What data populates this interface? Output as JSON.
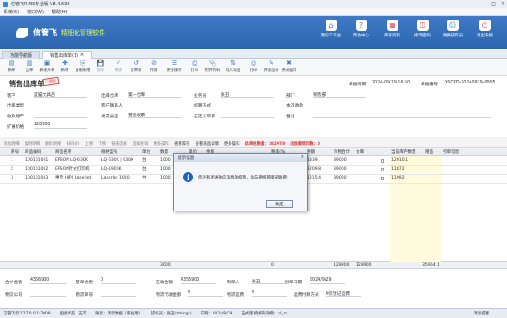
{
  "app": {
    "title": "信管飞RMIS专业版 V8.4.638"
  },
  "menu": [
    "系统(S)",
    "窗口(W)",
    "帮助(H)"
  ],
  "banner": {
    "brand": "信管飞",
    "slogan": "精细化管理软件",
    "buttons": [
      {
        "label": "我的工作台",
        "icon": "home-icon"
      },
      {
        "label": "帮助中心",
        "icon": "help-icon"
      },
      {
        "label": "库存资料",
        "icon": "inventory-icon"
      },
      {
        "label": "修改密码",
        "icon": "key-icon"
      },
      {
        "label": "更换操作员",
        "icon": "user-switch-icon"
      },
      {
        "label": "退出系统",
        "icon": "exit-icon"
      }
    ]
  },
  "tabs": [
    {
      "label": "功能导航版"
    },
    {
      "label": "销售出库单(1)"
    }
  ],
  "toolbar": [
    {
      "label": "新单",
      "icon": "new-doc-icon",
      "enabled": true
    },
    {
      "label": "品单",
      "icon": "goods-icon",
      "enabled": true
    },
    {
      "label": "新建开单",
      "icon": "open-order-icon",
      "enabled": true
    },
    {
      "label": "新增",
      "icon": "add-icon",
      "enabled": true
    },
    {
      "label": "复制新增",
      "icon": "copy-add-icon",
      "enabled": true
    },
    {
      "label": "保存",
      "icon": "save-icon",
      "enabled": false
    },
    {
      "label": "审核",
      "icon": "check-icon",
      "enabled": false
    },
    {
      "label": "反审核",
      "icon": "uncheck-icon",
      "enabled": true
    },
    {
      "label": "作废",
      "icon": "void-icon",
      "enabled": true
    },
    {
      "label": "更多操作",
      "icon": "more-ops-icon",
      "enabled": true
    },
    {
      "label": "打印",
      "icon": "print-icon",
      "enabled": true
    },
    {
      "label": "附件资料",
      "icon": "attachment-icon",
      "enabled": true
    },
    {
      "label": "导入导出",
      "icon": "import-export-icon",
      "enabled": true
    },
    {
      "label": "打印",
      "icon": "print2-icon",
      "enabled": true
    },
    {
      "label": "界面设计",
      "icon": "design-icon",
      "enabled": true
    },
    {
      "label": "关闭窗口",
      "icon": "close-window-icon",
      "enabled": true
    }
  ],
  "document": {
    "title": "销售出库单",
    "stamp": "已审核",
    "date_label": "单据日期",
    "date_value": "2024-09-29 16:50",
    "no_label": "单据编号",
    "no_value": "XSCKD-20240929-0005",
    "fields": {
      "customer_label": "客户",
      "customer_value": "蓝猫文具店",
      "warehouse_label": "出库仓库",
      "warehouse_value": "第一仓库",
      "salesman_label": "业务员",
      "salesman_value": "张丑",
      "dept_label": "部门",
      "dept_value": "销售部",
      "outtype_label": "出库类型",
      "outtype_value": "",
      "contact_label": "客户联系人",
      "contact_value": "",
      "settle_label": "结算方式",
      "settle_value": "",
      "status_label": "本次收款",
      "status_value": "",
      "account_label": "收款账户",
      "account_value": "",
      "invoice_label": "发票类型",
      "invoice_value": "普通发票",
      "custom_label": "自定义项目",
      "custom_value": "",
      "remark_label": "备注",
      "remark_value": "",
      "amount_label": "扩展价格",
      "amount_value": "128900"
    }
  },
  "gridbar": {
    "buttons": [
      "添加明细",
      "复制明细",
      "删除明细",
      "扫码(Y)",
      "上移",
      "下移",
      "快速选择",
      "超级查询",
      "更多操作",
      "查看库存",
      "查看商品详情",
      "更多操作"
    ],
    "total_label": "此单总数量：382978",
    "receive_label": "出收款项目数：0"
  },
  "grid": {
    "headers": [
      "序号",
      "商品编码",
      "商品名称",
      "规格型号",
      "单位",
      "数量",
      "单价",
      "金额",
      "税率(%)",
      "税额",
      "价税合计",
      "仓库",
      "当前库存数量",
      "赠品",
      "引单信息"
    ],
    "rows": [
      {
        "no": "1",
        "code": "100101001",
        "name": "EPSON LQ-630K",
        "spec": "LQ-630K | 630K",
        "unit": "台",
        "qty": "1000",
        "price": "",
        "amount": "",
        "tax_price": "1339",
        "tax_rate": "39000",
        "tax": "",
        "total": "",
        "wh": "",
        "stock": "12010.1"
      },
      {
        "no": "2",
        "code": "100101002",
        "name": "EPSON针式打印机",
        "spec": "LQ-1900K",
        "unit": "台",
        "qty": "1000",
        "price": "",
        "amount": "",
        "tax_price": "1209.8",
        "tax_rate": "39000",
        "tax": "",
        "total": "",
        "wh": "",
        "stock": "11872"
      },
      {
        "no": "3",
        "code": "100101003",
        "name": "惠普 (HP) LaserJet",
        "spec": "LaserJet 1020",
        "unit": "台",
        "qty": "1000",
        "price": "",
        "amount": "",
        "tax_price": "1215.4",
        "tax_rate": "39000",
        "tax": "",
        "total": "",
        "wh": "",
        "stock": "11992"
      }
    ],
    "totals": {
      "qty": "3000",
      "a": "0",
      "b": "128900",
      "c": "128900",
      "d": "35964.1"
    }
  },
  "footer": {
    "total_amount_label": "合计金额",
    "total_amount_value": "4356900",
    "discount_label": "整单优惠",
    "discount_value": "0",
    "receivable_label": "应收金额",
    "receivable_value": "4356900",
    "maker_label": "制单人",
    "maker_value": "张丑",
    "make_date_label": "制单日期",
    "make_date_value": "2024/9/29",
    "logistics_label": "物流公司",
    "logistics_value": "",
    "logistics_no_label": "物流单号",
    "logistics_no_value": "",
    "logistics_fee_label": "物流代收金额",
    "logistics_fee_value": "0",
    "shipping_label": "物流运费",
    "shipping_value": "0",
    "freight_label": "运费付款方式",
    "freight_value": "4仅登记运费"
  },
  "status": {
    "server": "信管飞云 127.0.0.1:7009",
    "conn": "连接状态：正常",
    "account": "账套：演示数据（系统用）",
    "operator": "操作员：张丑(zhangc)",
    "date": "日期：2024/9/29",
    "expire": "正式版 授权有效期：pl_zy",
    "msg": "消息提醒"
  },
  "dialog": {
    "title": "提示信息",
    "message": "您没有发送微信消息的权限，请与系统管理员联系!",
    "ok": "确定"
  }
}
